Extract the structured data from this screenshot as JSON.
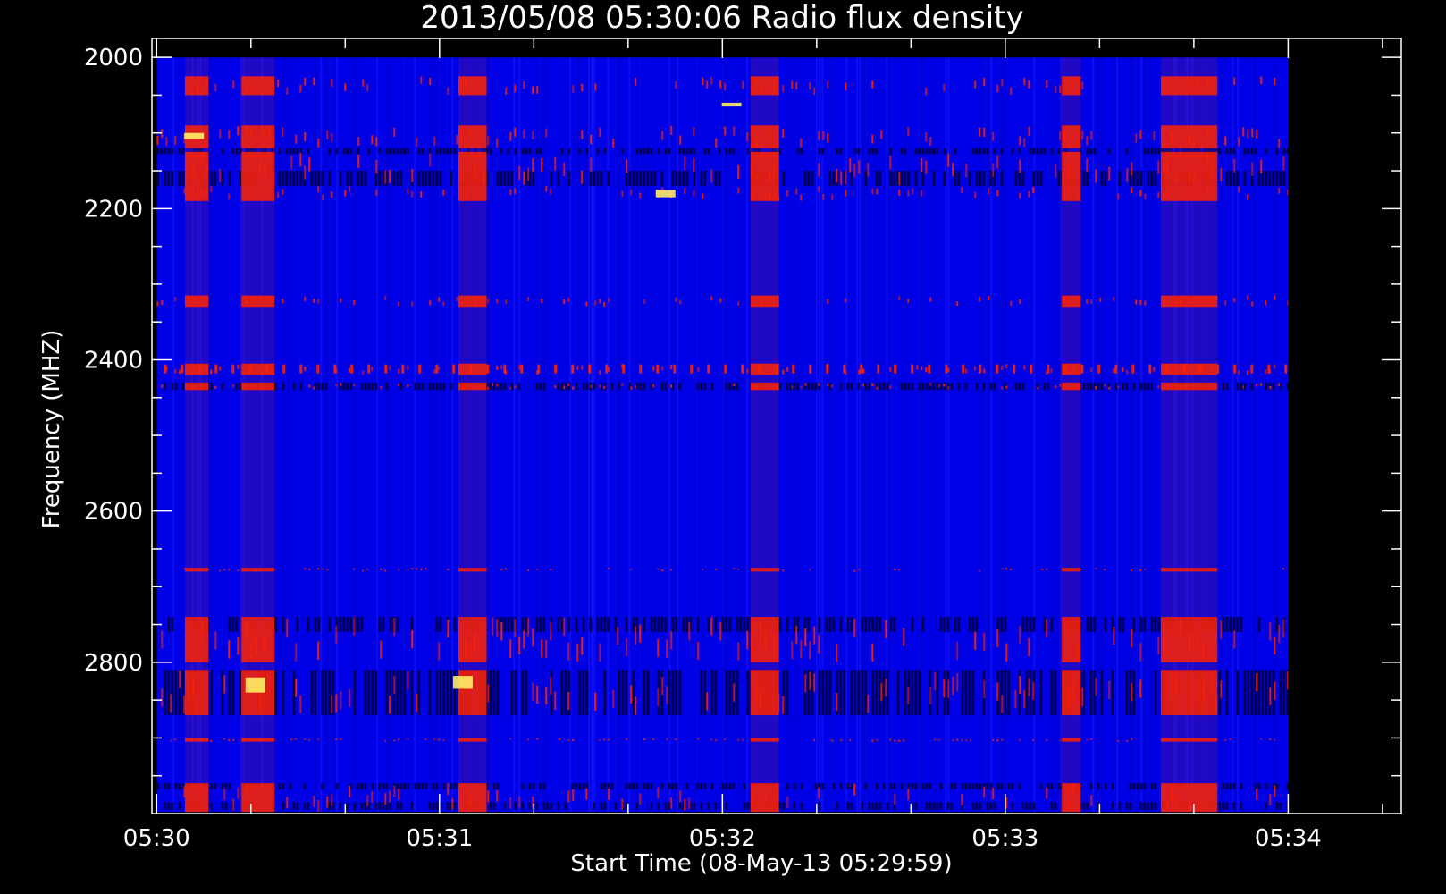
{
  "chart_data": {
    "type": "heatmap",
    "title": "2013/05/08 05:30:06 Radio flux density",
    "xlabel": "Start Time (08-May-13 05:29:59)",
    "ylabel": "Frequency (MHZ)",
    "x_tick_labels": [
      "05:30",
      "05:31",
      "05:32",
      "05:33",
      "05:34"
    ],
    "y_tick_labels": [
      "2000",
      "2200",
      "2400",
      "2600",
      "2800"
    ],
    "y_ticks": [
      2000,
      2200,
      2400,
      2600,
      2800
    ],
    "xlim_seconds": [
      0,
      265
    ],
    "ylim": [
      1975,
      3000
    ],
    "data_extent": {
      "x_seconds": [
        1,
        241
      ],
      "y": [
        2000,
        2998
      ]
    },
    "colors": {
      "background": "#000000",
      "axes": "#ffffff",
      "low": "#0000e6",
      "mid": "#1010ff",
      "high": "#ff2200",
      "peak": "#ffee66"
    },
    "bright_time_bands_seconds": [
      [
        7,
        12
      ],
      [
        19,
        26
      ],
      [
        65,
        71
      ],
      [
        127,
        133
      ],
      [
        193,
        197
      ],
      [
        214,
        226
      ]
    ],
    "rfi_frequency_bands": [
      [
        2025,
        2050
      ],
      [
        2090,
        2120
      ],
      [
        2125,
        2170
      ],
      [
        2170,
        2190
      ],
      [
        2315,
        2330
      ],
      [
        2405,
        2420
      ],
      [
        2430,
        2440
      ],
      [
        2675,
        2680
      ],
      [
        2740,
        2800
      ],
      [
        2810,
        2870
      ],
      [
        2900,
        2905
      ],
      [
        2960,
        2998
      ]
    ]
  }
}
